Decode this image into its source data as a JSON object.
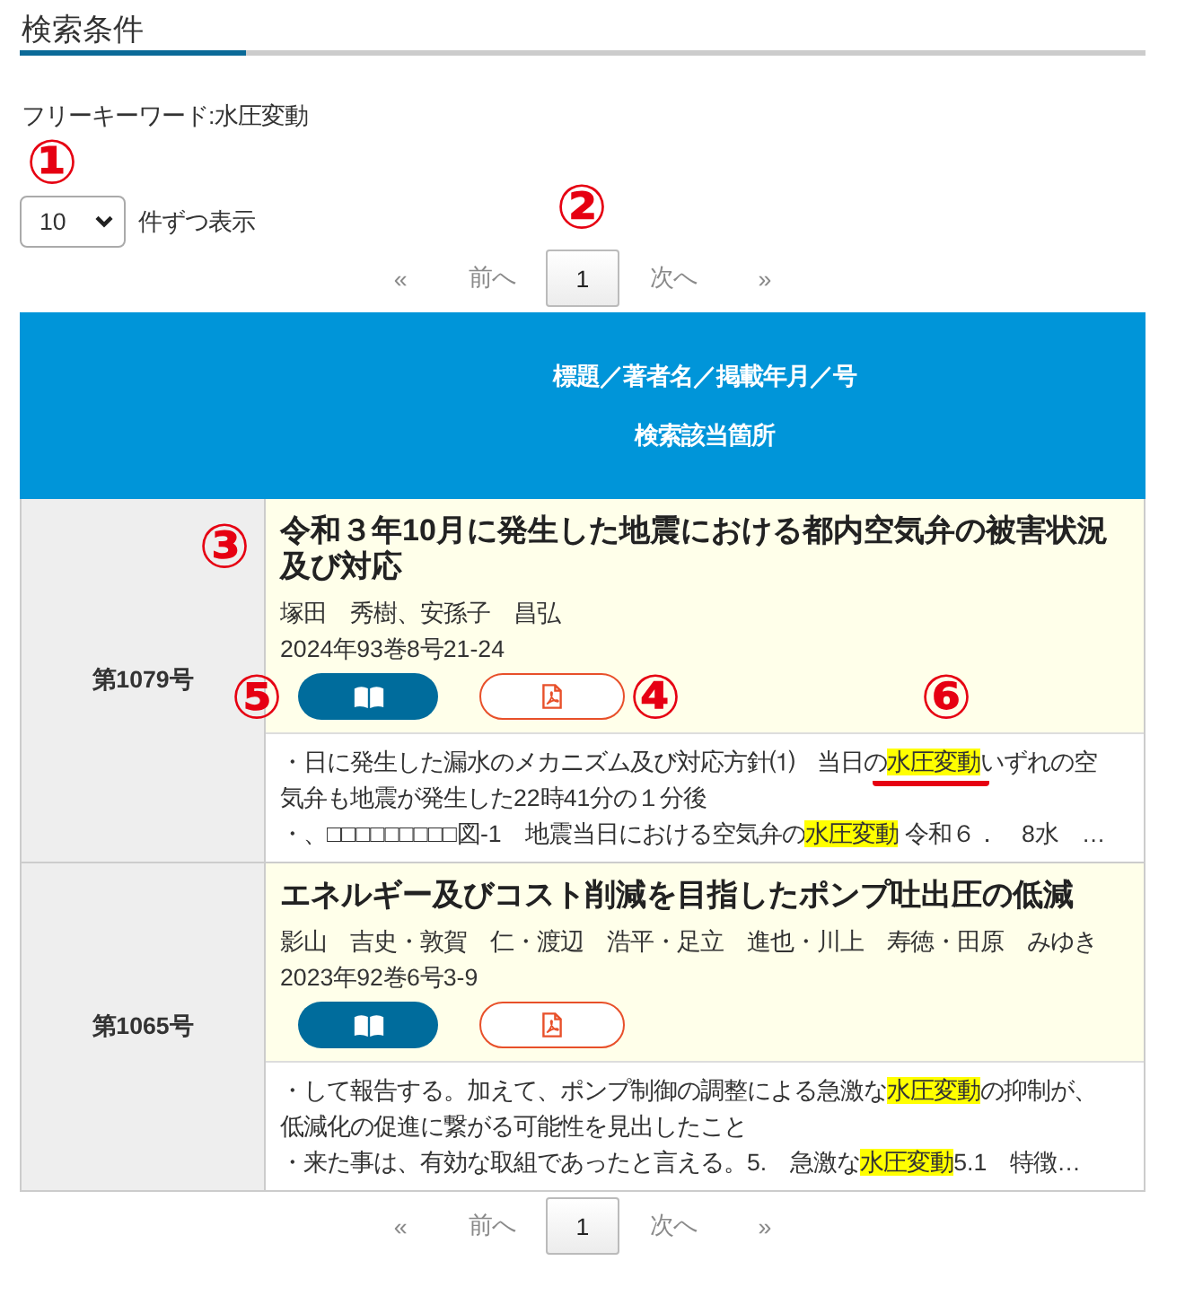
{
  "section_title": "検索条件",
  "keyword": "フリーキーワード:水圧変動",
  "per_page": {
    "value": "10",
    "label": "件ずつ表示",
    "callout": "①"
  },
  "pagination_top": {
    "callout": "②",
    "items": [
      {
        "label": "«",
        "disabled": true,
        "selected": false
      },
      {
        "label": "前へ",
        "disabled": true,
        "selected": false
      },
      {
        "label": "1",
        "disabled": false,
        "selected": true
      },
      {
        "label": "次へ",
        "disabled": true,
        "selected": false
      },
      {
        "label": "»",
        "disabled": true,
        "selected": false
      }
    ]
  },
  "table": {
    "header": [
      "標題／著者名／掲載年月／号",
      "検索該当箇所"
    ],
    "rows": [
      {
        "issue": "第1079号",
        "title": "令和３年10月に発生した地震における都内空気弁の被害状況及び対応",
        "title_callout": "③",
        "authors": "塚田　秀樹、安孫子　昌弘",
        "published": "2024年93巻8号21-24",
        "buttons": [
          {
            "kind": "viewer",
            "callout": "⑤"
          },
          {
            "kind": "pdf",
            "callout": "④"
          }
        ],
        "snippets": [
          {
            "callout": "⑥",
            "segments": [
              {
                "text": "・日に発生した漏水のメカニズム及び対応方針⑴　当日の",
                "highlight": false,
                "underlined": false
              },
              {
                "text": "水圧変動",
                "highlight": true,
                "underlined": true
              },
              {
                "text": "いずれの空気弁も地震が発生した22時41分の１分後",
                "highlight": false,
                "underlined": false
              }
            ]
          },
          {
            "segments": [
              {
                "text": "・、□□□□□□□□□図-1　地震当日における空気弁の",
                "highlight": false,
                "underlined": false
              },
              {
                "text": "水圧変動",
                "highlight": true,
                "underlined": false
              },
              {
                "text": " 令和６．　8水　…",
                "highlight": false,
                "underlined": false
              }
            ]
          }
        ]
      },
      {
        "issue": "第1065号",
        "title": "エネルギー及びコスト削減を目指したポンプ吐出圧の低減",
        "authors": "影山　吉史・敦賀　仁・渡辺　浩平・足立　進也・川上　寿徳・田原　みゆき",
        "published": "2023年92巻6号3-9",
        "buttons": [
          {
            "kind": "viewer"
          },
          {
            "kind": "pdf"
          }
        ],
        "snippets": [
          {
            "segments": [
              {
                "text": "・して報告する。加えて、ポンプ制御の調整による急激な",
                "highlight": false,
                "underlined": false
              },
              {
                "text": "水圧変動",
                "highlight": true,
                "underlined": false
              },
              {
                "text": "の抑制が、低減化の促進に繋がる可能性を見出したこと",
                "highlight": false,
                "underlined": false
              }
            ]
          },
          {
            "segments": [
              {
                "text": "・来た事は、有効な取組であったと言える。5.　急激な",
                "highlight": false,
                "underlined": false
              },
              {
                "text": "水圧変動",
                "highlight": true,
                "underlined": false
              },
              {
                "text": "5.1　特徴…",
                "highlight": false,
                "underlined": false
              }
            ]
          }
        ]
      }
    ]
  },
  "pagination_bottom": {
    "items": [
      {
        "label": "«",
        "disabled": true,
        "selected": false
      },
      {
        "label": "前へ",
        "disabled": true,
        "selected": false
      },
      {
        "label": "1",
        "disabled": false,
        "selected": true
      },
      {
        "label": "次へ",
        "disabled": true,
        "selected": false
      },
      {
        "label": "»",
        "disabled": true,
        "selected": false
      }
    ]
  }
}
